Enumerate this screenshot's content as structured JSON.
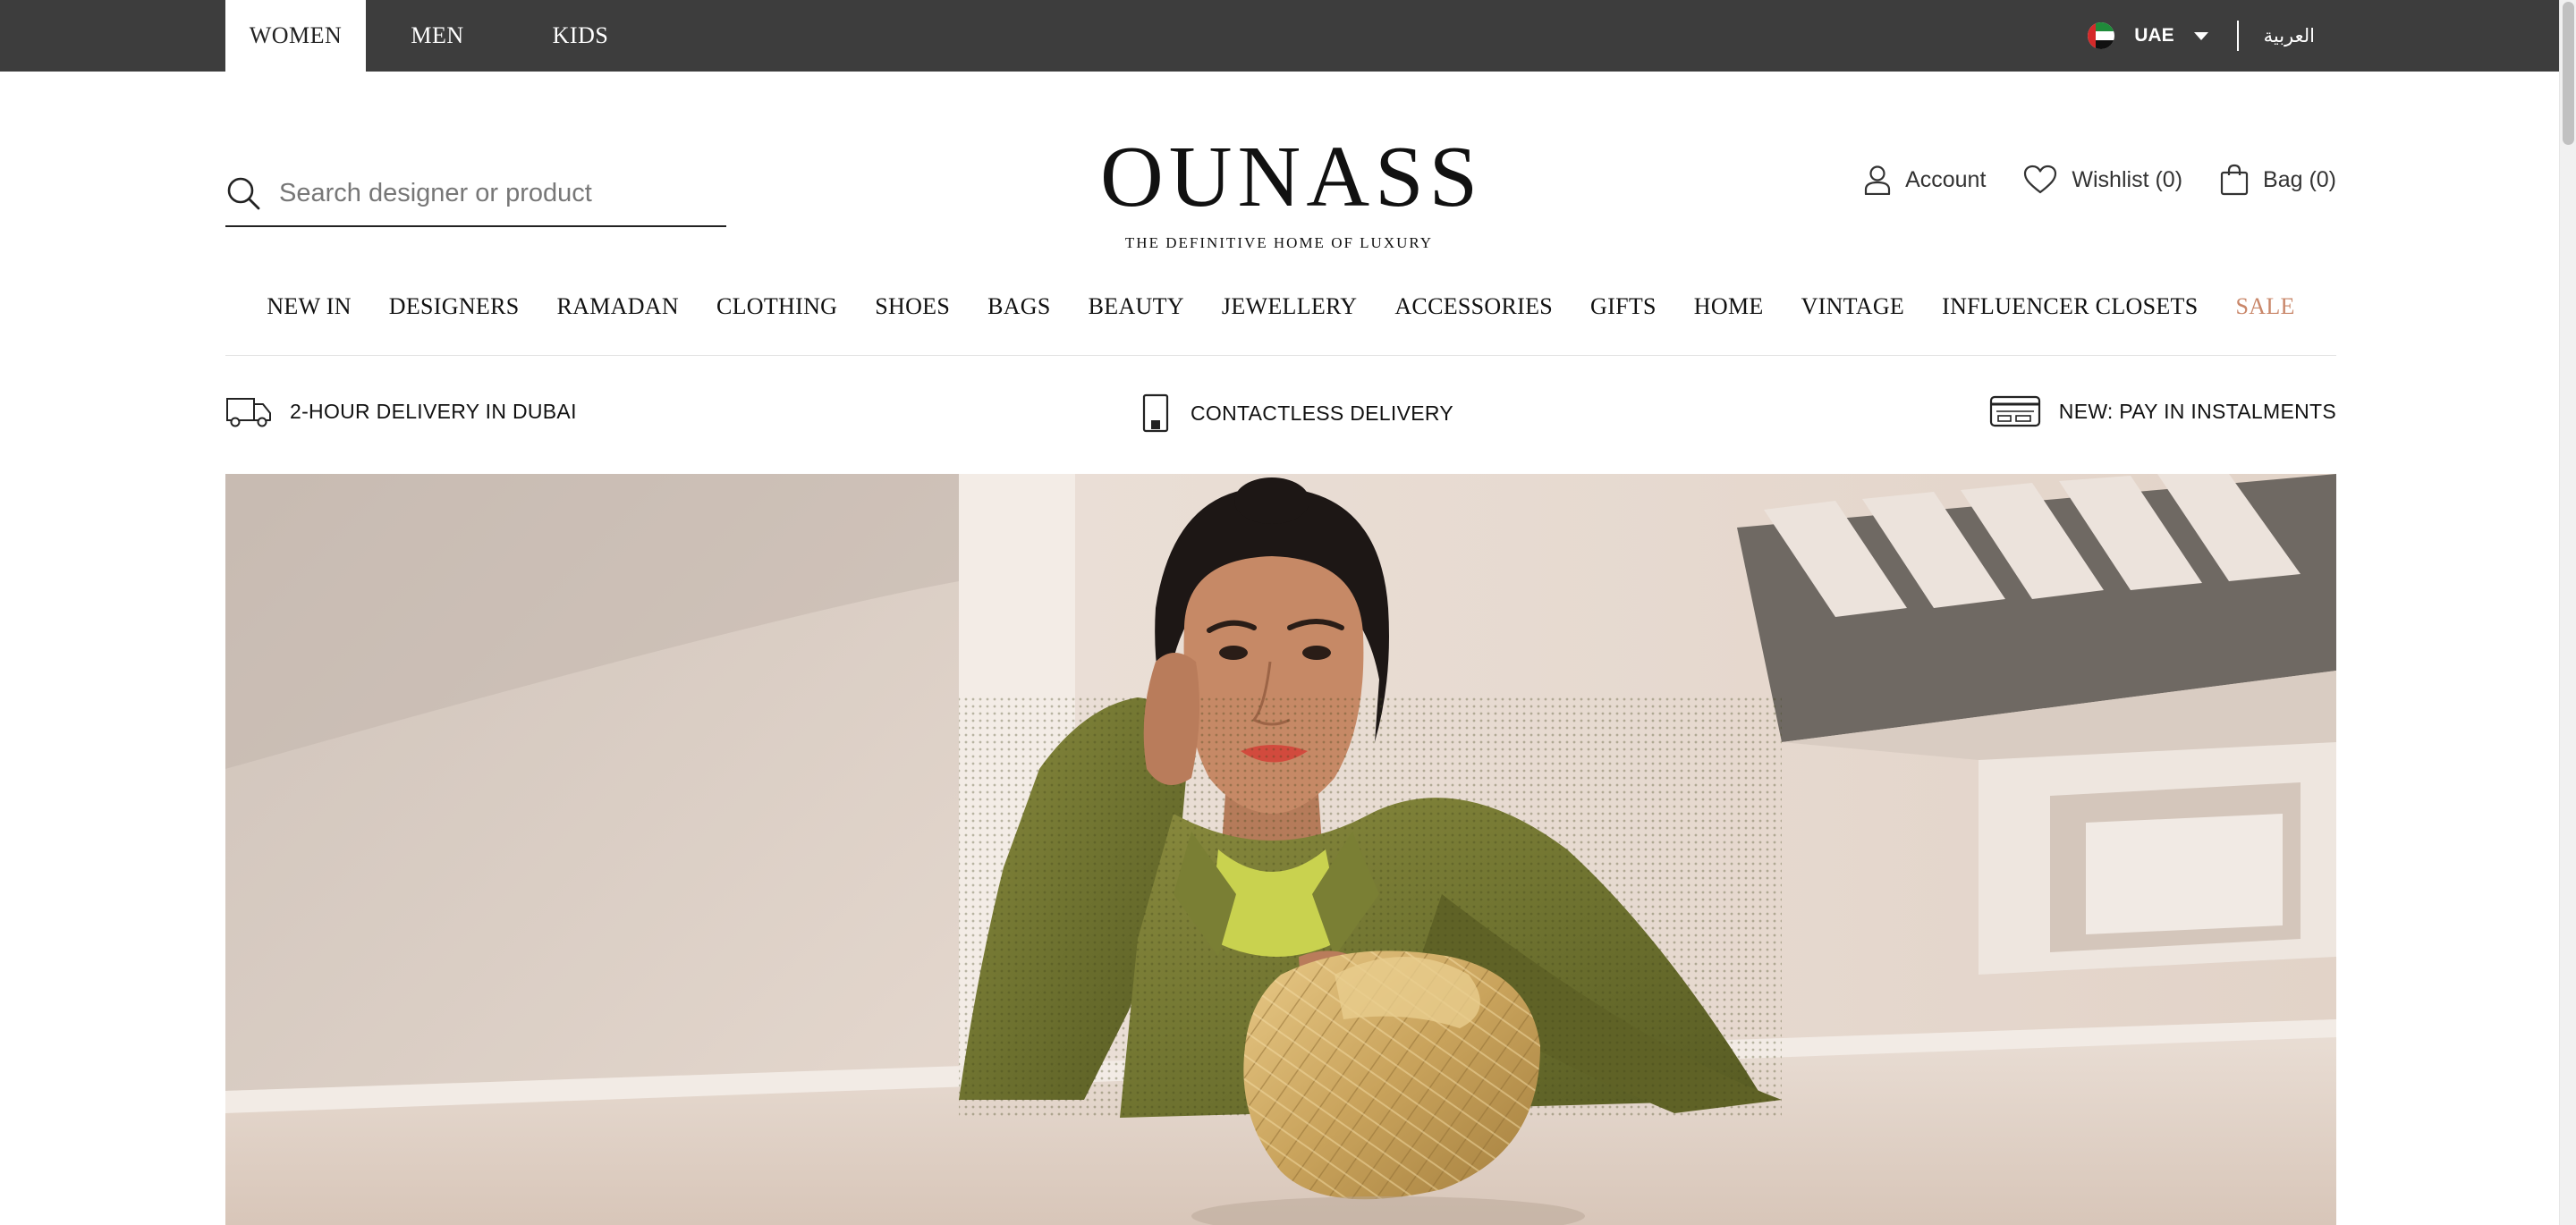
{
  "topbar": {
    "gender_tabs": [
      {
        "label": "WOMEN",
        "active": true
      },
      {
        "label": "MEN",
        "active": false
      },
      {
        "label": "KIDS",
        "active": false
      }
    ],
    "country": "UAE",
    "language": "العربية"
  },
  "header": {
    "search_placeholder": "Search designer or product",
    "logo": "OUNASS",
    "tagline": "THE DEFINITIVE HOME OF LUXURY",
    "account_label": "Account",
    "wishlist_label": "Wishlist (0)",
    "bag_label": "Bag (0)"
  },
  "nav": {
    "categories": [
      "NEW IN",
      "DESIGNERS",
      "RAMADAN",
      "CLOTHING",
      "SHOES",
      "BAGS",
      "BEAUTY",
      "JEWELLERY",
      "ACCESSORIES",
      "GIFTS",
      "HOME",
      "VINTAGE",
      "INFLUENCER CLOSETS",
      "SALE"
    ]
  },
  "usps": [
    {
      "label": "2-HOUR DELIVERY IN DUBAI",
      "icon": "delivery-van-icon"
    },
    {
      "label": "CONTACTLESS DELIVERY",
      "icon": "phone-box-icon"
    },
    {
      "label": "NEW: PAY IN INSTALMENTS",
      "icon": "credit-card-icon"
    }
  ],
  "colors": {
    "topbar_bg": "#3d3d3d",
    "sale": "#c9876a",
    "text": "#111111"
  }
}
